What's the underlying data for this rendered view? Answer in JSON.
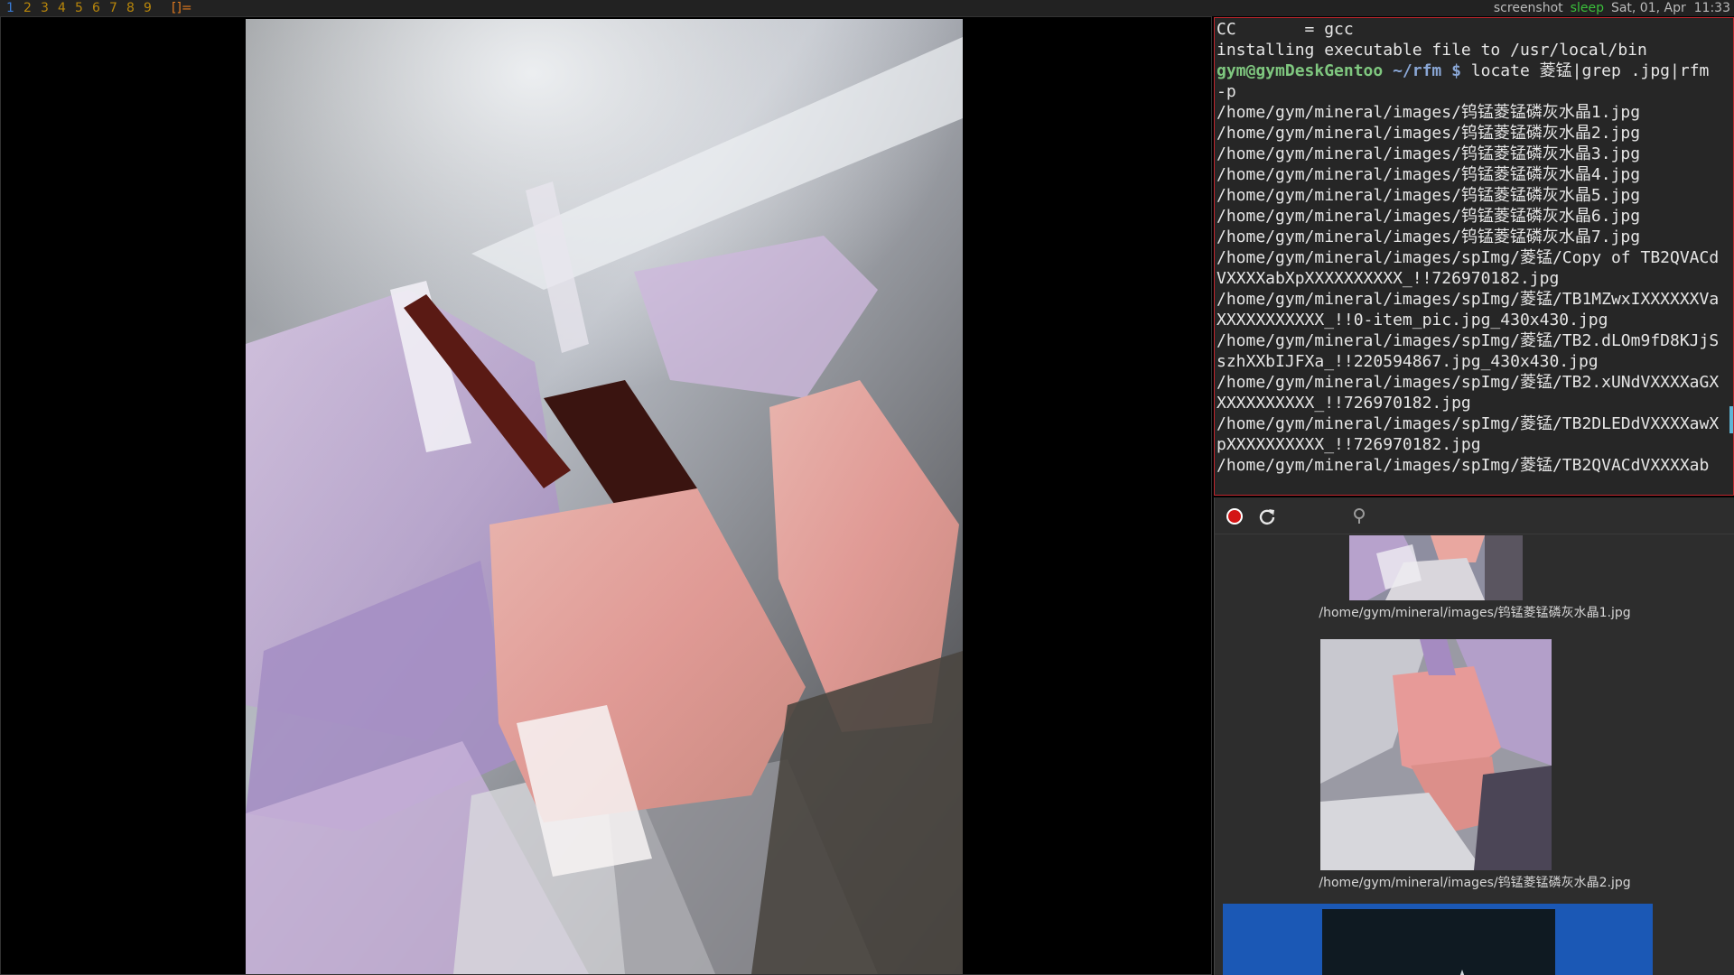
{
  "topbar": {
    "tags": [
      "1",
      "2",
      "3",
      "4",
      "5",
      "6",
      "7",
      "8",
      "9"
    ],
    "active_tag": "1",
    "layout_symbol": "[]=",
    "status_screenshot": "screenshot",
    "status_sleep": "sleep",
    "status_datetime": "Sat, 01, Apr  11:33"
  },
  "terminal": {
    "lines": [
      "CC       = gcc",
      "installing executable file to /usr/local/bin"
    ],
    "prompt_user": "gym@gymDeskGentoo",
    "prompt_path": "~/rfm",
    "prompt_symbol": "$",
    "command": "locate 菱锰|grep .jpg|rfm -p",
    "output": [
      "/home/gym/mineral/images/钨锰菱锰磷灰水晶1.jpg",
      "/home/gym/mineral/images/钨锰菱锰磷灰水晶2.jpg",
      "/home/gym/mineral/images/钨锰菱锰磷灰水晶3.jpg",
      "/home/gym/mineral/images/钨锰菱锰磷灰水晶4.jpg",
      "/home/gym/mineral/images/钨锰菱锰磷灰水晶5.jpg",
      "/home/gym/mineral/images/钨锰菱锰磷灰水晶6.jpg",
      "/home/gym/mineral/images/钨锰菱锰磷灰水晶7.jpg",
      "/home/gym/mineral/images/spImg/菱锰/Copy of TB2QVACdVXXXXabXpXXXXXXXXXX_!!726970182.jpg",
      "/home/gym/mineral/images/spImg/菱锰/TB1MZwxIXXXXXXVaXXXXXXXXXXX_!!0-item_pic.jpg_430x430.jpg",
      "/home/gym/mineral/images/spImg/菱锰/TB2.dLOm9fD8KJjSszhXXbIJFXa_!!220594867.jpg_430x430.jpg",
      "/home/gym/mineral/images/spImg/菱锰/TB2.xUNdVXXXXaGXXXXXXXXXXX_!!726970182.jpg",
      "/home/gym/mineral/images/spImg/菱锰/TB2DLEDdVXXXXawXpXXXXXXXXXX_!!726970182.jpg",
      "/home/gym/mineral/images/spImg/菱锰/TB2QVACdVXXXXab"
    ]
  },
  "filemanager": {
    "toolbar": {
      "stop_icon": "record-stop-icon",
      "refresh_icon": "refresh-icon",
      "pin_icon": "pin-icon"
    },
    "items": [
      {
        "name": "/home/gym/mineral/images/钨锰菱锰磷灰水晶1.jpg"
      },
      {
        "name": "/home/gym/mineral/images/钨锰菱锰磷灰水晶2.jpg"
      }
    ]
  },
  "colors": {
    "terminal_border": "#c0262d",
    "selection": "#1b58b5",
    "prompt_user": "#7fc77f",
    "prompt_path": "#8aa7d6",
    "sleep_status": "#3bbf3b"
  }
}
